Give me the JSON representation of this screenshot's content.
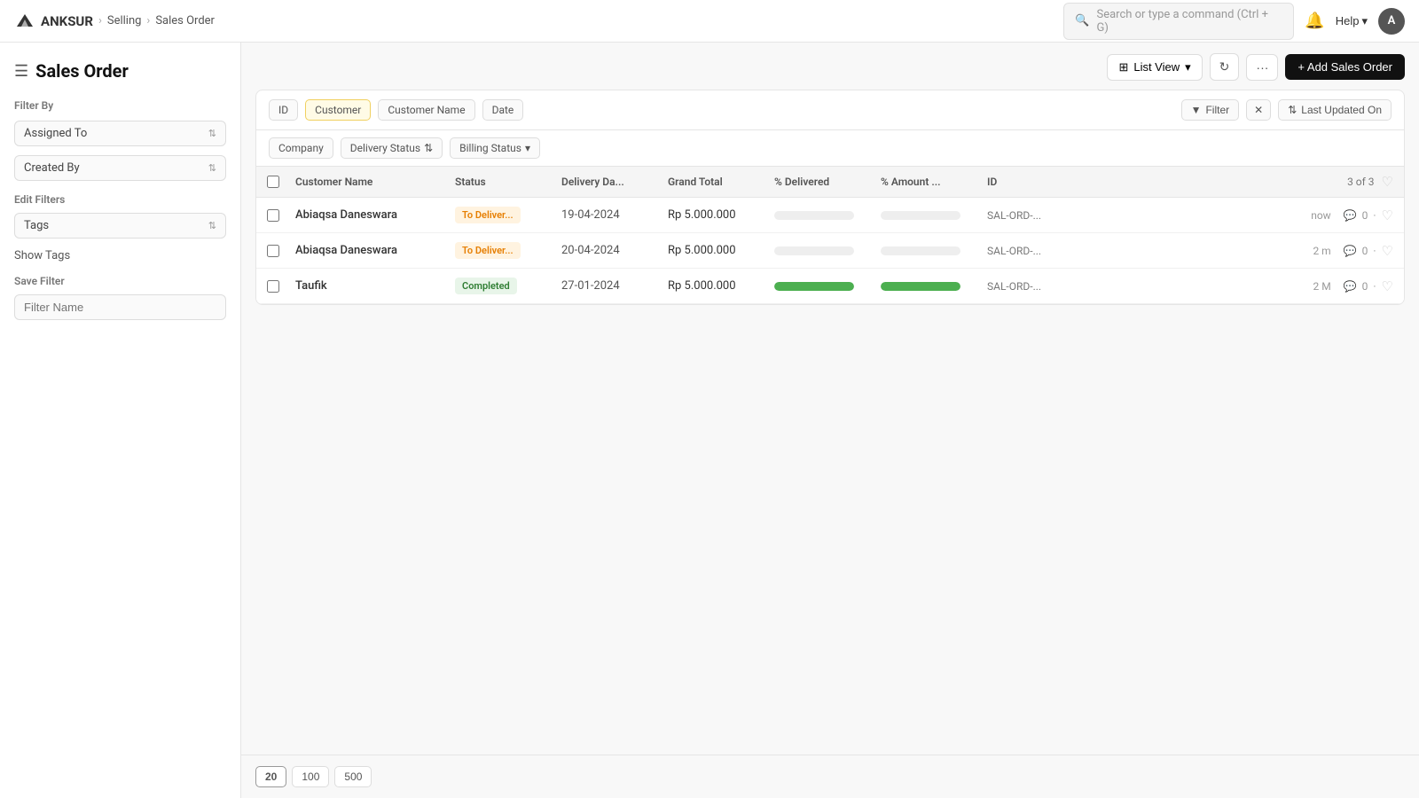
{
  "app": {
    "logo_text": "ANKSUR",
    "breadcrumb": [
      "Selling",
      "Sales Order"
    ],
    "search_placeholder": "Search or type a command (Ctrl + G)",
    "help_label": "Help",
    "avatar_label": "A"
  },
  "sidebar": {
    "hamburger": "☰",
    "page_title": "Sales Order",
    "filter_by_label": "Filter By",
    "assigned_to_label": "Assigned To",
    "created_by_label": "Created By",
    "edit_filters_label": "Edit Filters",
    "tags_label": "Tags",
    "show_tags_label": "Show Tags",
    "save_filter_label": "Save Filter",
    "filter_name_placeholder": "Filter Name"
  },
  "toolbar": {
    "list_view_label": "List View",
    "add_button_label": "+ Add Sales Order"
  },
  "filter_tags": {
    "row1": [
      "ID",
      "Customer",
      "Customer Name",
      "Date"
    ],
    "row2_items": [
      "Company",
      "Delivery Status",
      "Billing Status"
    ],
    "filter_label": "Filter",
    "last_updated_label": "Last Updated On"
  },
  "table": {
    "columns": [
      "Customer Name",
      "Status",
      "Delivery Da...",
      "Grand Total",
      "% Delivered",
      "% Amount ...",
      "ID"
    ],
    "count_label": "3 of 3",
    "rows": [
      {
        "customer_name": "Abiaqsa Daneswara",
        "status": "To Deliver...",
        "status_type": "to-deliver",
        "delivery_date": "19-04-2024",
        "grand_total": "Rp 5.000.000",
        "delivered_pct": 0,
        "amount_pct": 0,
        "id": "SAL-ORD-...",
        "time": "now",
        "comments": "0"
      },
      {
        "customer_name": "Abiaqsa Daneswara",
        "status": "To Deliver...",
        "status_type": "to-deliver",
        "delivery_date": "20-04-2024",
        "grand_total": "Rp 5.000.000",
        "delivered_pct": 0,
        "amount_pct": 0,
        "id": "SAL-ORD-...",
        "time": "2 m",
        "comments": "0"
      },
      {
        "customer_name": "Taufik",
        "status": "Completed",
        "status_type": "completed",
        "delivery_date": "27-01-2024",
        "grand_total": "Rp 5.000.000",
        "delivered_pct": 100,
        "amount_pct": 100,
        "id": "SAL-ORD-...",
        "time": "2 M",
        "comments": "0"
      }
    ]
  },
  "pagination": {
    "sizes": [
      "20",
      "100",
      "500"
    ]
  }
}
